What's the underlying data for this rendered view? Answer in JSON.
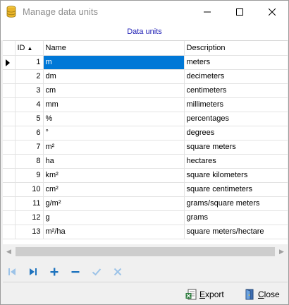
{
  "window": {
    "title": "Manage data units",
    "app_icon": "database-icon",
    "controls": [
      "minimize-icon",
      "maximize-icon",
      "close-icon"
    ]
  },
  "caption": "Data units",
  "grid": {
    "columns": [
      {
        "label": "ID",
        "sort": "ascending"
      },
      {
        "label": "Name"
      },
      {
        "label": "Description"
      }
    ],
    "selected_row": 0,
    "rows": [
      {
        "id": "1",
        "name": "m",
        "description": "meters"
      },
      {
        "id": "2",
        "name": "dm",
        "description": "decimeters"
      },
      {
        "id": "3",
        "name": "cm",
        "description": "centimeters"
      },
      {
        "id": "4",
        "name": "mm",
        "description": "millimeters"
      },
      {
        "id": "5",
        "name": "%",
        "description": "percentages"
      },
      {
        "id": "6",
        "name": "°",
        "description": "degrees"
      },
      {
        "id": "7",
        "name": "m²",
        "description": "square meters"
      },
      {
        "id": "8",
        "name": "ha",
        "description": "hectares"
      },
      {
        "id": "9",
        "name": "km²",
        "description": "square kilometers"
      },
      {
        "id": "10",
        "name": "cm²",
        "description": "square centimeters"
      },
      {
        "id": "11",
        "name": "g/m²",
        "description": "grams/square meters"
      },
      {
        "id": "12",
        "name": "g",
        "description": "grams"
      },
      {
        "id": "13",
        "name": "m²/ha",
        "description": "square meters/hectare"
      }
    ]
  },
  "navigator": {
    "buttons": [
      "first-record-icon",
      "last-record-icon",
      "add-icon",
      "delete-icon",
      "post-icon",
      "cancel-icon"
    ]
  },
  "buttons": {
    "export_label": "Export",
    "close_label": "Close"
  },
  "colors": {
    "accent": "#0078d7",
    "caption": "#1c1cb4",
    "nav_blue": "#1e73be"
  }
}
